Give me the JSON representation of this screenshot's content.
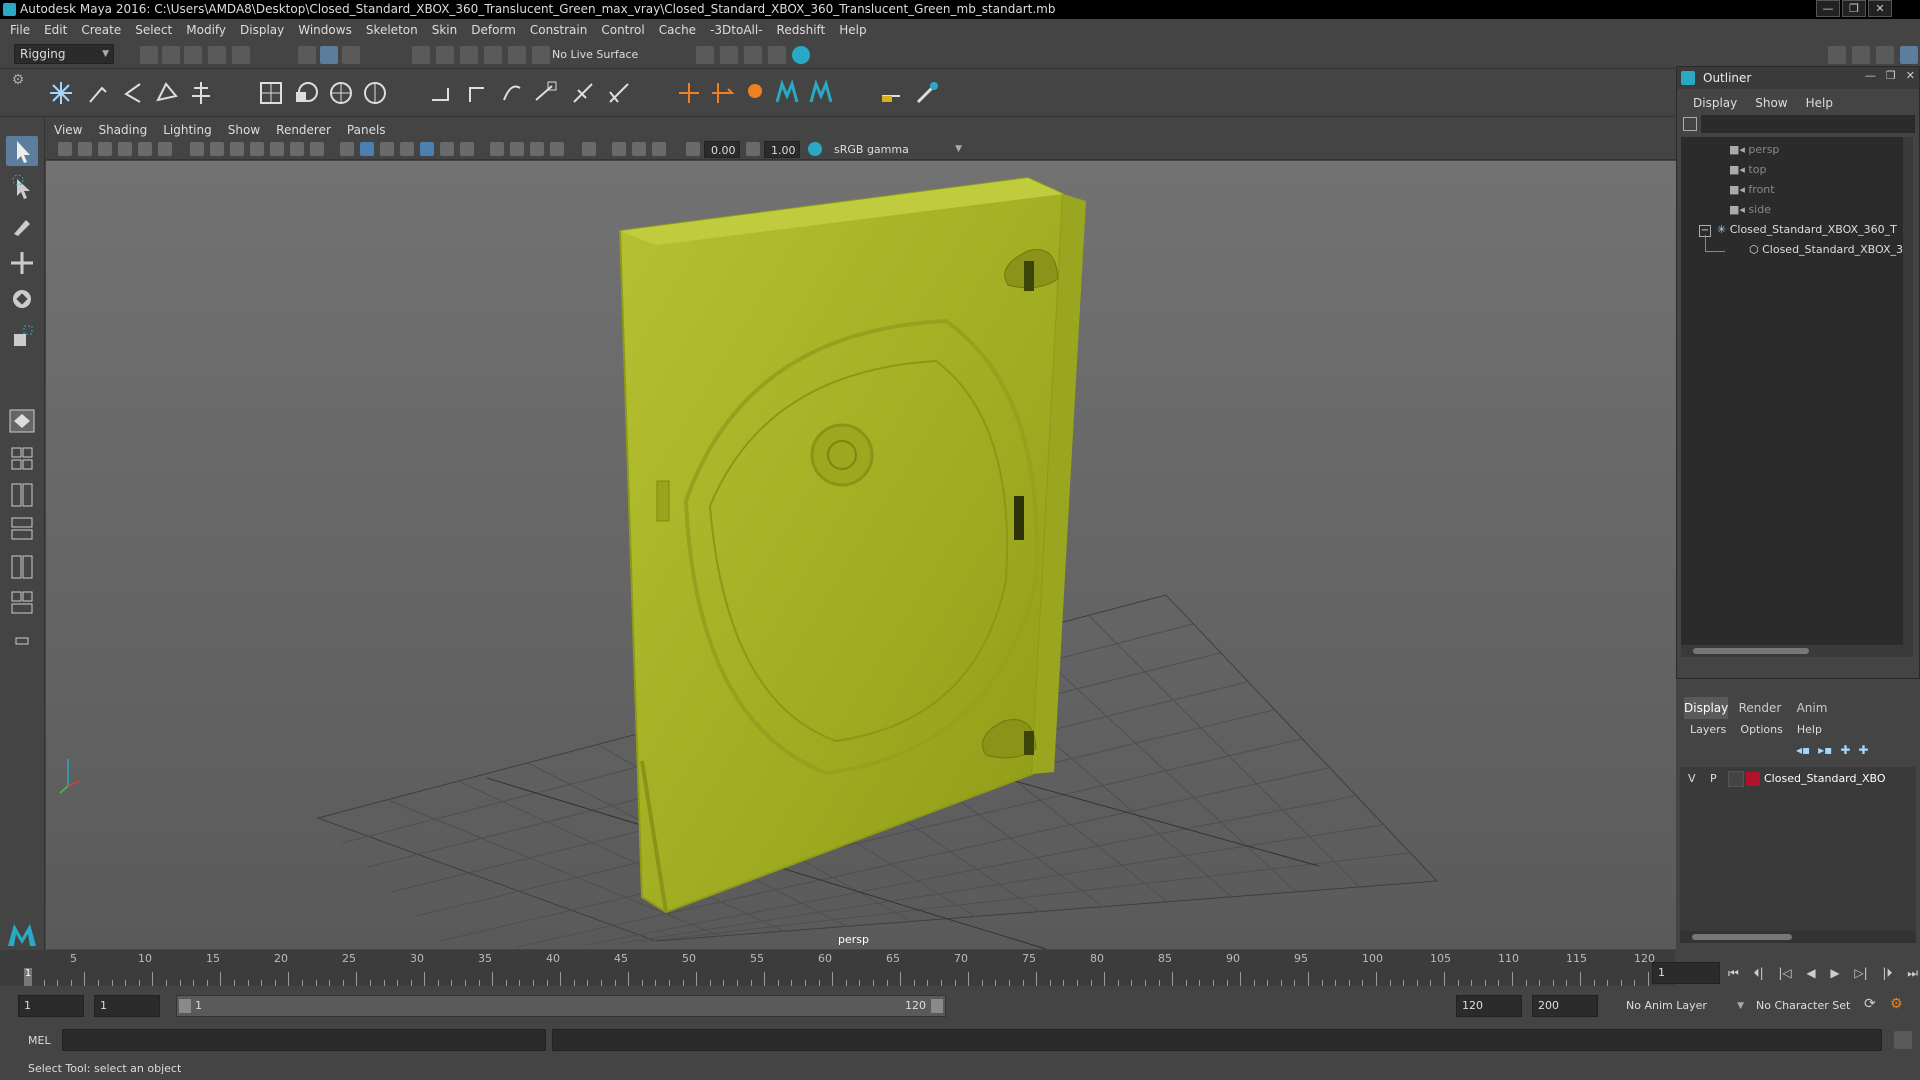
{
  "window": {
    "title": "Autodesk Maya 2016: C:\\Users\\AMDA8\\Desktop\\Closed_Standard_XBOX_360_Translucent_Green_max_vray\\Closed_Standard_XBOX_360_Translucent_Green_mb_standart.mb",
    "buttons": [
      "—",
      "❐",
      "✕"
    ]
  },
  "menubar": [
    "File",
    "Edit",
    "Create",
    "Select",
    "Modify",
    "Display",
    "Windows",
    "Skeleton",
    "Skin",
    "Deform",
    "Constrain",
    "Control",
    "Cache",
    "-3DtoAll-",
    "Redshift",
    "Help"
  ],
  "statusline": {
    "menuset": "Rigging",
    "live_surface": "No Live Surface"
  },
  "panel": {
    "menus": [
      "View",
      "Shading",
      "Lighting",
      "Show",
      "Renderer",
      "Panels"
    ],
    "exposure": "0.00",
    "gamma": "1.00",
    "colorspace": "sRGB gamma",
    "camera_label": "persp"
  },
  "outliner": {
    "title": "Outliner",
    "menus": [
      "Display",
      "Show",
      "Help"
    ],
    "items": [
      {
        "label": "persp",
        "kind": "camera"
      },
      {
        "label": "top",
        "kind": "camera"
      },
      {
        "label": "front",
        "kind": "camera"
      },
      {
        "label": "side",
        "kind": "camera"
      },
      {
        "label": "Closed_Standard_XBOX_360_T",
        "kind": "group"
      },
      {
        "label": "Closed_Standard_XBOX_3€",
        "kind": "mesh"
      }
    ]
  },
  "layers": {
    "tabs": [
      "Display",
      "Render",
      "Anim"
    ],
    "active_tab": "Display",
    "menus": [
      "Layers",
      "Options",
      "Help"
    ],
    "layer": {
      "v": "V",
      "p": "P",
      "name": "Closed_Standard_XBO",
      "color": "#b0122c"
    }
  },
  "timeline": {
    "ticks": [
      "5",
      "10",
      "15",
      "20",
      "25",
      "30",
      "35",
      "40",
      "45",
      "50",
      "55",
      "60",
      "65",
      "70",
      "75",
      "80",
      "85",
      "90",
      "95",
      "100",
      "105",
      "110",
      "115",
      "120"
    ],
    "current_frame_marker": "1",
    "current_frame_field": "1"
  },
  "range": {
    "start": "1",
    "playback_start": "1",
    "slider_start": "1",
    "slider_end": "120",
    "playback_end": "120",
    "end": "200",
    "anim_layer": "No Anim Layer",
    "character_set": "No Character Set"
  },
  "command": {
    "language": "MEL"
  },
  "help_line": "Select Tool: select an object",
  "colors": {
    "case_green": "#a9b628",
    "viewport_bg": "#6b6b6b",
    "accent_blue": "#5c7d9c",
    "maya_teal": "#2aa9c5"
  }
}
